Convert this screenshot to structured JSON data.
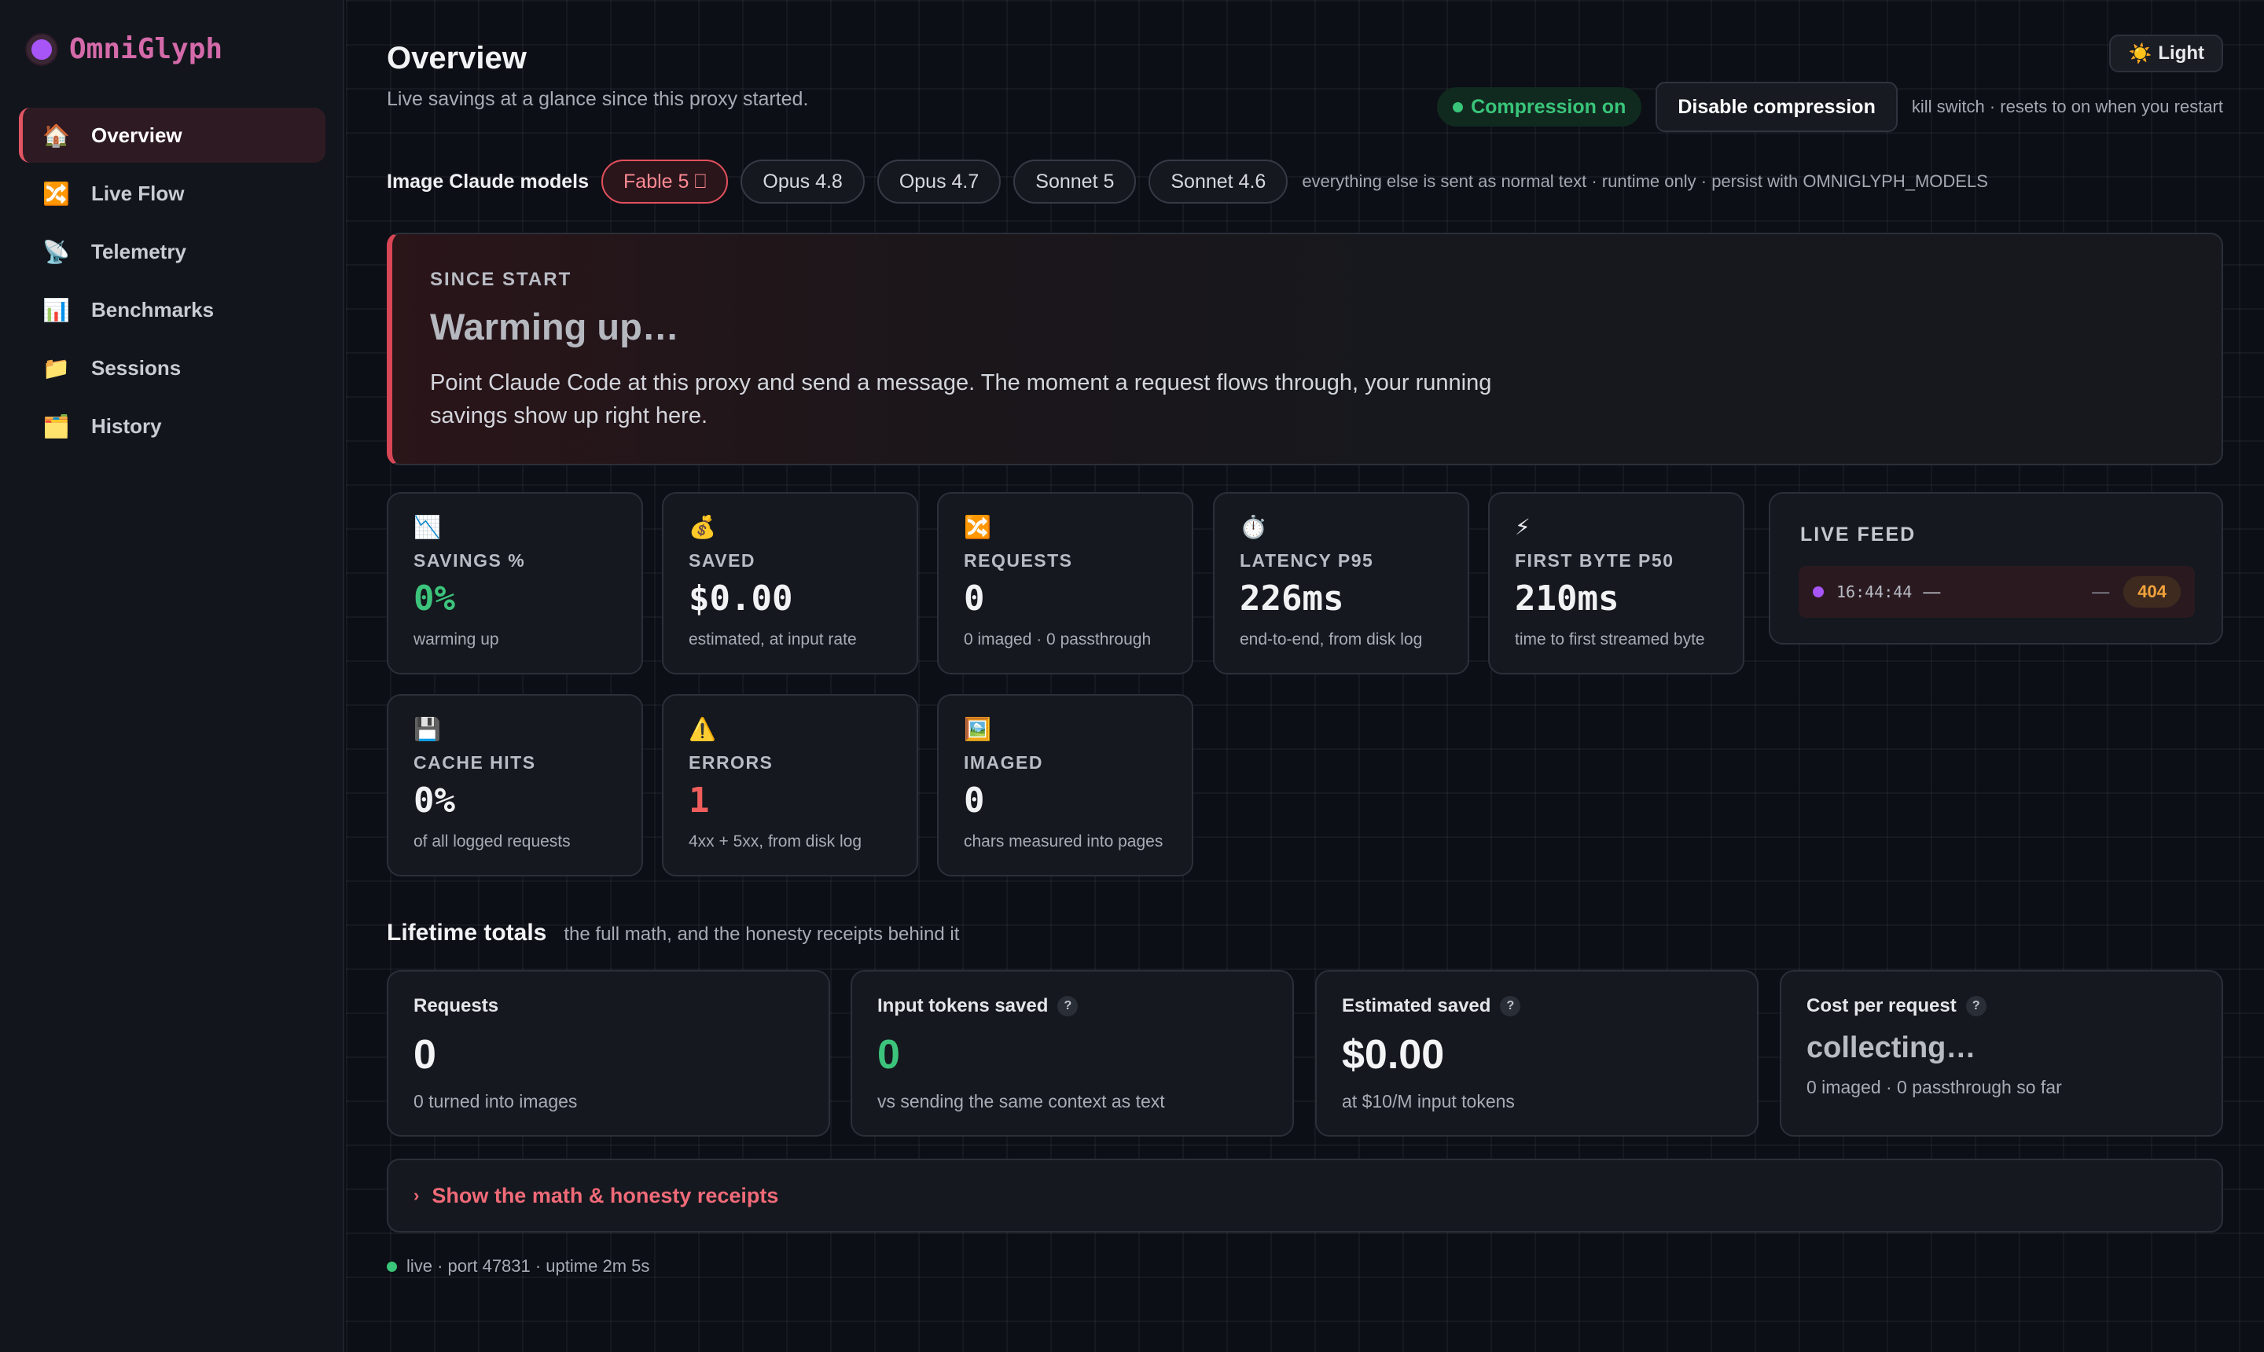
{
  "app": {
    "name": "OmniGlyph"
  },
  "sidebar": {
    "items": [
      {
        "icon": "house-icon",
        "glyph": "🏠",
        "label": "Overview",
        "active": true
      },
      {
        "icon": "shuffle-icon",
        "glyph": "🔀",
        "label": "Live Flow"
      },
      {
        "icon": "satellite-icon",
        "glyph": "📡",
        "label": "Telemetry"
      },
      {
        "icon": "bar-chart-icon",
        "glyph": "📊",
        "label": "Benchmarks"
      },
      {
        "icon": "folder-icon",
        "glyph": "📁",
        "label": "Sessions"
      },
      {
        "icon": "card-box-icon",
        "glyph": "🗂️",
        "label": "History"
      }
    ]
  },
  "header": {
    "title": "Overview",
    "subtitle": "Live savings at a glance since this proxy started.",
    "theme_button": {
      "glyph": "☀️",
      "label": "Light"
    },
    "compression_status": "Compression on",
    "compression_button": "Disable compression",
    "compression_note": "kill switch · resets to on when you restart"
  },
  "models": {
    "label": "Image Claude models",
    "chips": [
      {
        "label": "Fable 5 ⎕",
        "selected": true
      },
      {
        "label": "Opus 4.8"
      },
      {
        "label": "Opus 4.7"
      },
      {
        "label": "Sonnet 5"
      },
      {
        "label": "Sonnet 4.6"
      }
    ],
    "note": "everything else is sent as normal text · runtime only · persist with OMNIGLYPH_MODELS"
  },
  "hero": {
    "kicker": "SINCE START",
    "title": "Warming up…",
    "body": "Point Claude Code at this proxy and send a message. The moment a request flows through, your running savings show up right here."
  },
  "stats": [
    {
      "icon": "chart-down-icon",
      "glyph": "📉",
      "label": "SAVINGS %",
      "value": "0%",
      "sub": "warming up",
      "tone": "green"
    },
    {
      "icon": "money-bag-icon",
      "glyph": "💰",
      "label": "SAVED",
      "value": "$0.00",
      "sub": "estimated, at input rate"
    },
    {
      "icon": "shuffle-icon",
      "glyph": "🔀",
      "label": "REQUESTS",
      "value": "0",
      "sub": "0 imaged · 0 passthrough"
    },
    {
      "icon": "stopwatch-icon",
      "glyph": "⏱️",
      "label": "LATENCY P95",
      "value": "226ms",
      "sub": "end-to-end, from disk log"
    },
    {
      "icon": "lightning-icon",
      "glyph": "⚡",
      "label": "FIRST BYTE P50",
      "value": "210ms",
      "sub": "time to first streamed byte"
    },
    {
      "icon": "floppy-disk-icon",
      "glyph": "💾",
      "label": "CACHE HITS",
      "value": "0%",
      "sub": "of all logged requests"
    },
    {
      "icon": "warning-icon",
      "glyph": "⚠️",
      "label": "ERRORS",
      "value": "1",
      "sub": "4xx + 5xx, from disk log",
      "tone": "red"
    },
    {
      "icon": "framed-picture-icon",
      "glyph": "🖼️",
      "label": "IMAGED",
      "value": "0",
      "sub": "chars measured into pages"
    }
  ],
  "live_feed": {
    "title": "LIVE FEED",
    "entry": {
      "time": "16:44:44",
      "dash": "—",
      "dash2": "—",
      "status": "404"
    }
  },
  "lifetime": {
    "title": "Lifetime totals",
    "subtitle": "the full math, and the honesty receipts behind it",
    "cards": [
      {
        "label": "Requests",
        "value": "0",
        "sub": "0 turned into images"
      },
      {
        "label": "Input tokens saved",
        "help": "?",
        "value": "0",
        "sub": "vs sending the same context as text",
        "tone": "green"
      },
      {
        "label": "Estimated saved",
        "help": "?",
        "value": "$0.00",
        "sub": "at $10/M input tokens"
      },
      {
        "label": "Cost per request",
        "help": "?",
        "value": "collecting…",
        "sub": "0 imaged · 0 passthrough so far",
        "tone": "muted"
      }
    ]
  },
  "receipts": {
    "chevron": "›",
    "label": "Show the math & honesty receipts"
  },
  "footer": {
    "status": "live · port 47831 · uptime 2m 5s"
  },
  "colors": {
    "accent": "#e25563",
    "green": "#3cc47c",
    "red": "#ef5d5d",
    "purple": "#a855f7",
    "orange": "#f2a23c"
  }
}
